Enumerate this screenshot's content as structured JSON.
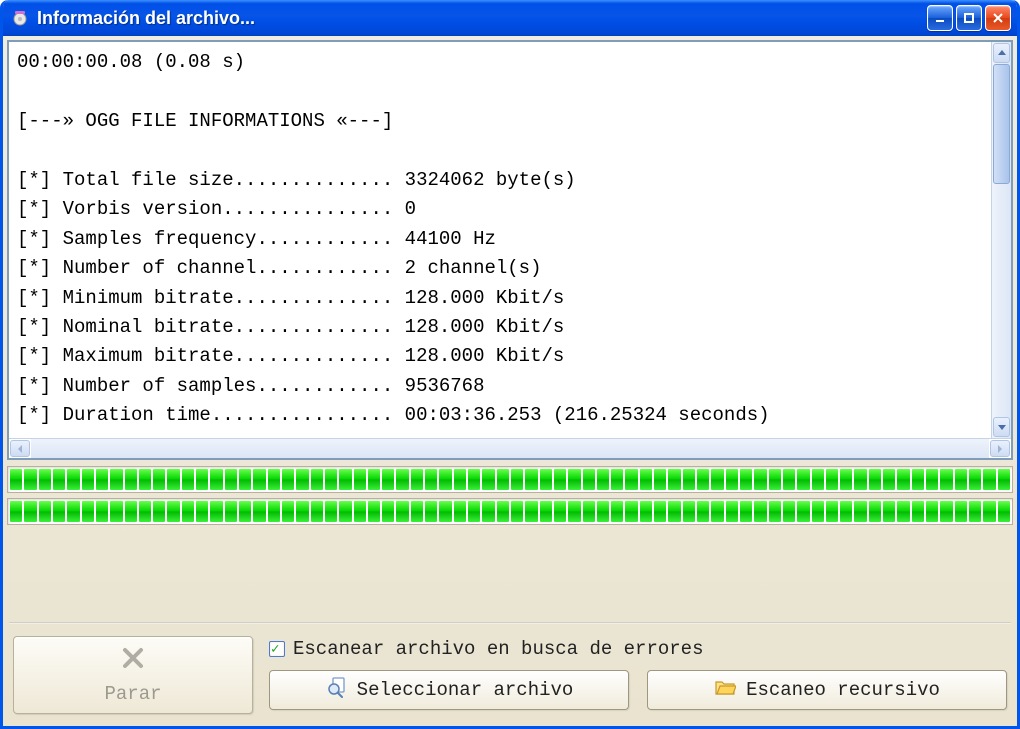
{
  "window": {
    "title": "Información del archivo..."
  },
  "output": {
    "line1": "00:00:00.08 (0.08 s)",
    "blank1": "",
    "header": "[---» OGG FILE INFORMATIONS «---]",
    "blank2": "",
    "rows": [
      "[*] Total file size.............. 3324062 byte(s)",
      "[*] Vorbis version............... 0",
      "[*] Samples frequency............ 44100 Hz",
      "[*] Number of channel............ 2 channel(s)",
      "[*] Minimum bitrate.............. 128.000 Kbit/s",
      "[*] Nominal bitrate.............. 128.000 Kbit/s",
      "[*] Maximum bitrate.............. 128.000 Kbit/s",
      "[*] Number of samples............ 9536768",
      "[*] Duration time................ 00:03:36.253 (216.25324 seconds)"
    ]
  },
  "progress": {
    "segments": 70,
    "percent1": 100,
    "percent2": 100
  },
  "buttons": {
    "stop": "Parar",
    "scan_errors_label": "Escanear archivo en busca de errores",
    "scan_errors_checked": true,
    "select_file": "Seleccionar archivo",
    "recursive_scan": "Escaneo recursivo"
  }
}
